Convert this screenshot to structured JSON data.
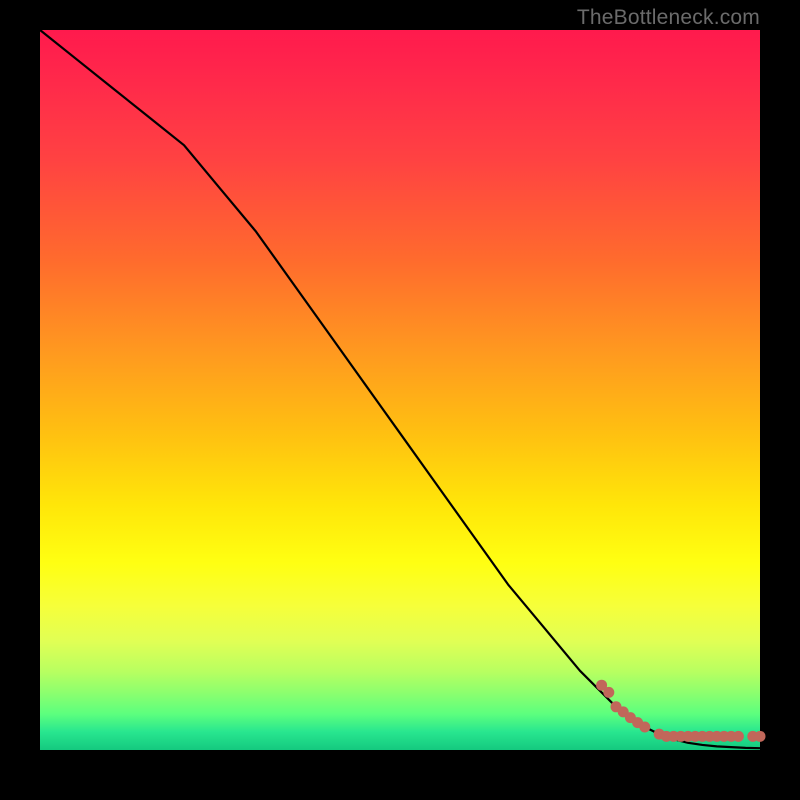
{
  "watermark": "TheBottleneck.com",
  "colors": {
    "line": "#000000",
    "marker_fill": "#c1675a",
    "marker_stroke": "#c1675a"
  },
  "chart_data": {
    "type": "line",
    "title": "",
    "xlabel": "",
    "ylabel": "",
    "xlim": [
      0,
      100
    ],
    "ylim": [
      0,
      100
    ],
    "grid": false,
    "legend": false,
    "series": [
      {
        "name": "curve",
        "type": "line",
        "x": [
          0,
          5,
          10,
          15,
          20,
          25,
          30,
          35,
          40,
          45,
          50,
          55,
          60,
          65,
          70,
          75,
          80,
          82,
          84,
          86,
          88,
          90,
          92,
          94,
          96,
          98,
          100
        ],
        "y": [
          100,
          96,
          92,
          88,
          84,
          78,
          72,
          65,
          58,
          51,
          44,
          37,
          30,
          23,
          17,
          11,
          6,
          4.5,
          3.2,
          2.2,
          1.5,
          1.0,
          0.7,
          0.5,
          0.4,
          0.3,
          0.25
        ]
      },
      {
        "name": "near-zero-markers",
        "type": "scatter",
        "x": [
          78,
          79,
          80,
          81,
          82,
          83,
          84,
          86,
          87,
          88,
          89,
          90,
          91,
          92,
          93,
          94,
          95,
          96,
          97,
          99,
          100
        ],
        "y": [
          9.0,
          8.0,
          6.0,
          5.3,
          4.5,
          3.8,
          3.2,
          2.2,
          1.9,
          1.9,
          1.9,
          1.9,
          1.9,
          1.9,
          1.9,
          1.9,
          1.9,
          1.9,
          1.9,
          1.9,
          1.9
        ]
      }
    ]
  }
}
